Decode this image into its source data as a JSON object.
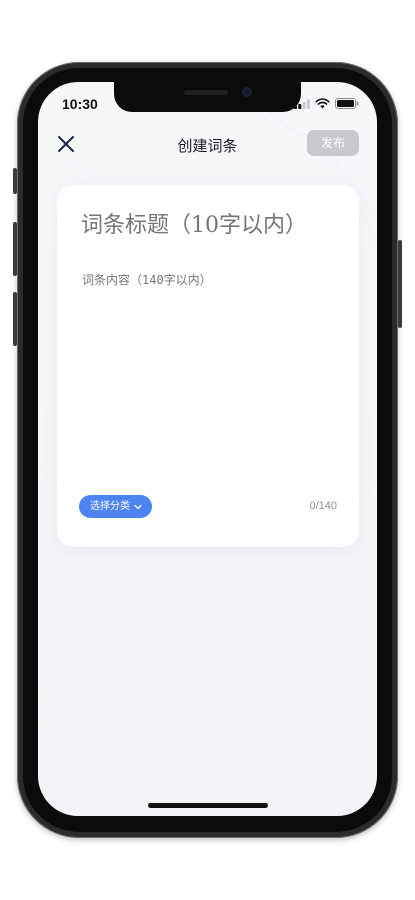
{
  "status_bar": {
    "time": "10:30"
  },
  "nav": {
    "title": "创建词条",
    "publish_label": "发布",
    "close_icon": "close-icon"
  },
  "editor": {
    "title_placeholder": "词条标题（10字以内）",
    "title_value": "",
    "content_placeholder": "词条内容（140字以内）",
    "content_value": "",
    "category_label": "选择分类",
    "char_count": "0/140"
  },
  "colors": {
    "accent": "#4d84f2",
    "publish_disabled": "#c8c9cd",
    "background": "#f5f6f8",
    "card": "#ffffff"
  }
}
